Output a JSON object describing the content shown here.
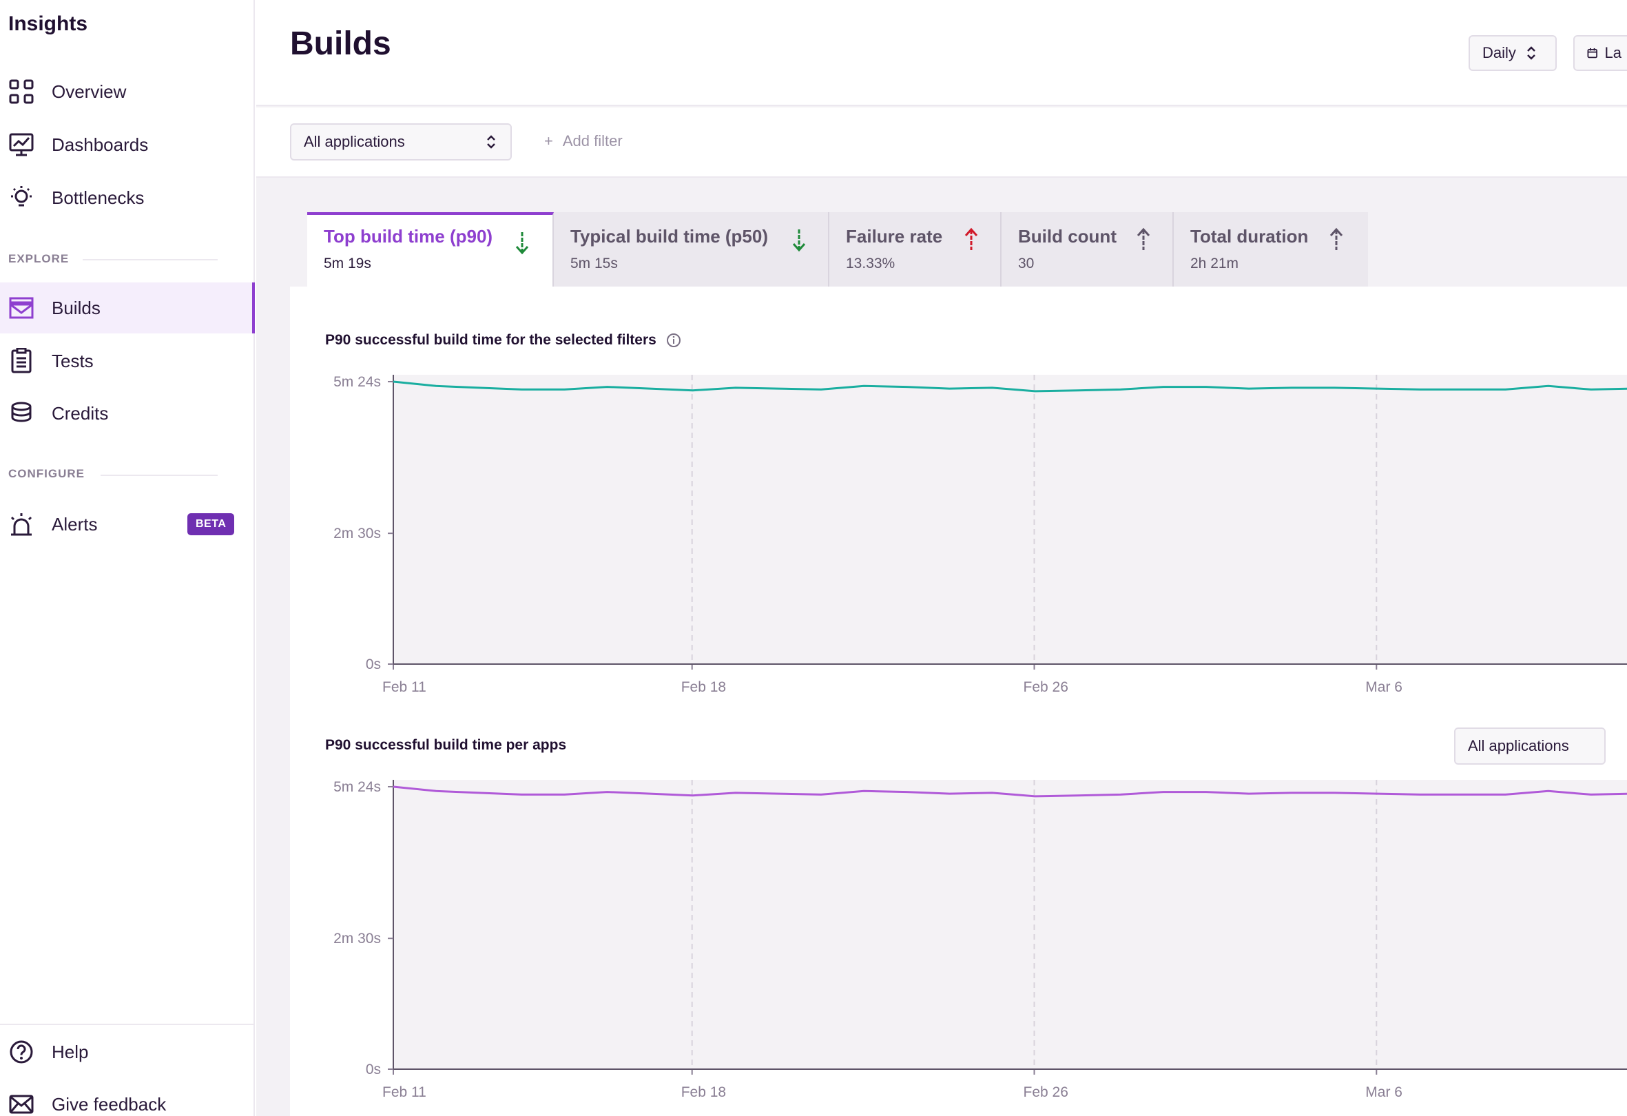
{
  "sidebar": {
    "title": "Insights",
    "items": [
      {
        "label": "Overview"
      },
      {
        "label": "Dashboards"
      },
      {
        "label": "Bottlenecks"
      },
      {
        "label": "Builds"
      },
      {
        "label": "Tests"
      },
      {
        "label": "Credits"
      },
      {
        "label": "Alerts",
        "badge": "BETA"
      }
    ],
    "sections": {
      "explore": "EXPLORE",
      "configure": "CONFIGURE"
    },
    "footer": [
      {
        "label": "Help"
      },
      {
        "label": "Give feedback"
      }
    ]
  },
  "header": {
    "title": "Builds",
    "interval": "Daily",
    "date_range_partial": "La"
  },
  "filters": {
    "app_select": "All applications",
    "add_filter": "Add filter"
  },
  "tabs": [
    {
      "label": "Top build time (p90)",
      "value": "5m 19s",
      "trend": "down",
      "trend_color": "#1f8a3a"
    },
    {
      "label": "Typical build time (p50)",
      "value": "5m 15s",
      "trend": "down",
      "trend_color": "#1f8a3a"
    },
    {
      "label": "Failure rate",
      "value": "13.33%",
      "trend": "up",
      "trend_color": "#d11a2a"
    },
    {
      "label": "Build count",
      "value": "30",
      "trend": "up",
      "trend_color": "#5e5468"
    },
    {
      "label": "Total duration",
      "value": "2h 21m",
      "trend": "up",
      "trend_color": "#5e5468"
    }
  ],
  "charts": {
    "chart1_title": "P90 successful build time for the selected filters",
    "chart2_title": "P90 successful build time per apps",
    "chart2_select": "All applications"
  },
  "chart_data": [
    {
      "type": "line",
      "title": "P90 successful build time for the selected filters",
      "color": "#1aaea0",
      "x_ticks": [
        "Feb 11",
        "Feb 18",
        "Feb 26",
        "Mar 6"
      ],
      "y_ticks": [
        "5m 24s",
        "2m 30s",
        "0s"
      ],
      "ylim": [
        0,
        324
      ],
      "x": [
        0,
        1,
        2,
        3,
        4,
        5,
        6,
        7,
        8,
        9,
        10,
        11,
        12,
        13,
        14,
        15,
        16,
        17,
        18,
        19,
        20,
        21,
        22,
        23,
        24,
        25,
        26,
        27,
        28,
        29
      ],
      "values": [
        324,
        319,
        317,
        315,
        315,
        318,
        316,
        314,
        317,
        316,
        315,
        319,
        318,
        316,
        317,
        313,
        314,
        315,
        318,
        318,
        316,
        317,
        317,
        316,
        315,
        315,
        315,
        319,
        315,
        316
      ]
    },
    {
      "type": "line",
      "title": "P90 successful build time per apps",
      "color": "#b05ad8",
      "x_ticks": [
        "Feb 11",
        "Feb 18",
        "Feb 26",
        "Mar 6"
      ],
      "y_ticks": [
        "5m 24s",
        "2m 30s",
        "0s"
      ],
      "ylim": [
        0,
        324
      ],
      "x": [
        0,
        1,
        2,
        3,
        4,
        5,
        6,
        7,
        8,
        9,
        10,
        11,
        12,
        13,
        14,
        15,
        16,
        17,
        18,
        19,
        20,
        21,
        22,
        23,
        24,
        25,
        26,
        27,
        28,
        29
      ],
      "values": [
        324,
        319,
        317,
        315,
        315,
        318,
        316,
        314,
        317,
        316,
        315,
        319,
        318,
        316,
        317,
        313,
        314,
        315,
        318,
        318,
        316,
        317,
        317,
        316,
        315,
        315,
        315,
        319,
        315,
        316
      ]
    }
  ]
}
